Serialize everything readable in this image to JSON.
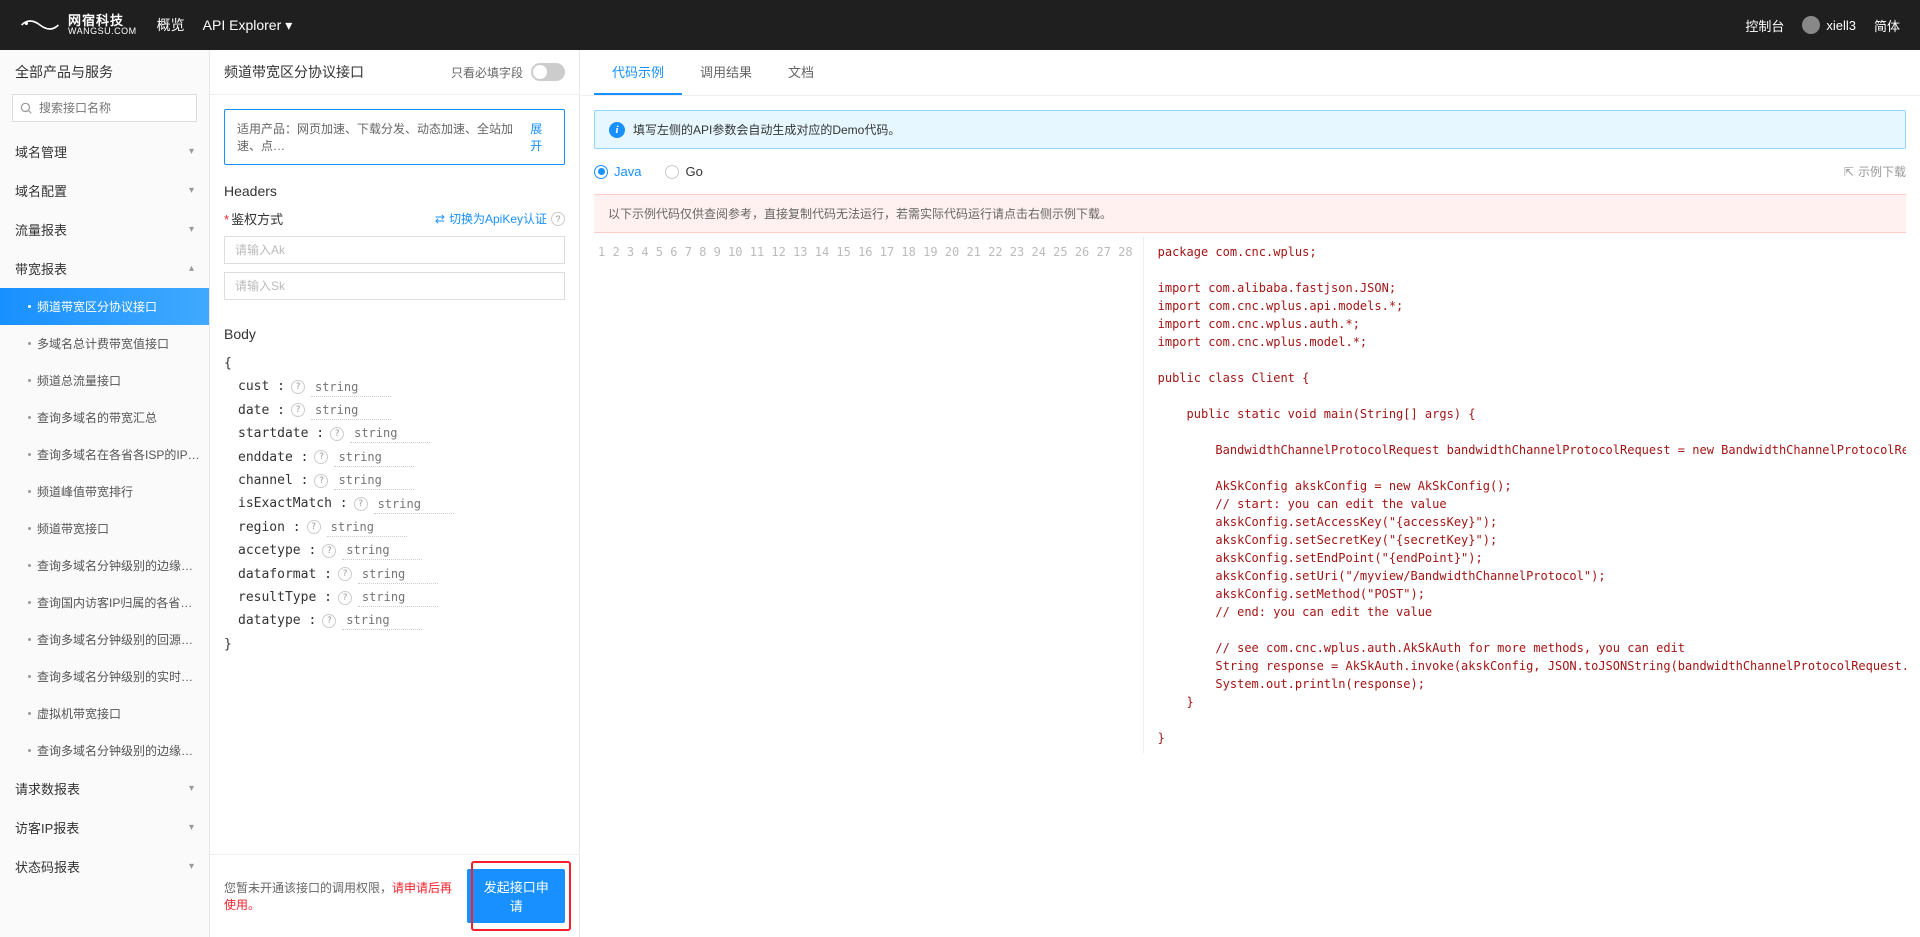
{
  "header": {
    "logo_cn": "网宿科技",
    "logo_en": "WANGSU.COM",
    "nav_overview": "概览",
    "nav_api_explorer": "API Explorer",
    "console": "控制台",
    "username": "xiell3",
    "lang": "简体"
  },
  "sidebar": {
    "title": "全部产品与服务",
    "search_placeholder": "搜索接口名称",
    "groups": [
      {
        "label": "域名管理",
        "expanded": false
      },
      {
        "label": "域名配置",
        "expanded": false
      },
      {
        "label": "流量报表",
        "expanded": false
      },
      {
        "label": "带宽报表",
        "expanded": true,
        "items": [
          "频道带宽区分协议接口",
          "多域名总计费带宽值接口",
          "频道总流量接口",
          "查询多域名的带宽汇总",
          "查询多域名在各省各ISP的IP…",
          "频道峰值带宽排行",
          "频道带宽接口",
          "查询多域名分钟级别的边缘…",
          "查询国内访客IP归属的各省…",
          "查询多域名分钟级别的回源…",
          "查询多域名分钟级别的实时…",
          "虚拟机带宽接口",
          "查询多域名分钟级别的边缘…"
        ]
      },
      {
        "label": "请求数报表",
        "expanded": false
      },
      {
        "label": "访客IP报表",
        "expanded": false
      },
      {
        "label": "状态码报表",
        "expanded": false
      }
    ]
  },
  "middle": {
    "title": "频道带宽区分协议接口",
    "required_only": "只看必填字段",
    "products_label": "适用产品：网页加速、下载分发、动态加速、全站加速、点…",
    "expand": "展开",
    "headers_title": "Headers",
    "auth_label": "鉴权方式",
    "auth_switch": "切换为ApiKey认证",
    "ak_placeholder": "请输入Ak",
    "sk_placeholder": "请输入Sk",
    "body_title": "Body",
    "body_fields": [
      {
        "key": "cust",
        "type": "string"
      },
      {
        "key": "date",
        "type": "string"
      },
      {
        "key": "startdate",
        "type": "string"
      },
      {
        "key": "enddate",
        "type": "string"
      },
      {
        "key": "channel",
        "type": "string"
      },
      {
        "key": "isExactMatch",
        "type": "string"
      },
      {
        "key": "region",
        "type": "string"
      },
      {
        "key": "accetype",
        "type": "string"
      },
      {
        "key": "dataformat",
        "type": "string"
      },
      {
        "key": "resultType",
        "type": "string"
      },
      {
        "key": "datatype",
        "type": "string"
      }
    ],
    "footer_warn_1": "您暂未开通该接口的调用权限，",
    "footer_warn_2": "请申请后再使用。",
    "submit": "发起接口申请"
  },
  "right": {
    "tabs": [
      "代码示例",
      "调用结果",
      "文档"
    ],
    "alert": "填写左侧的API参数会自动生成对应的Demo代码。",
    "lang_java": "Java",
    "lang_go": "Go",
    "download": "示例下载",
    "code_hint": "以下示例代码仅供查阅参考，直接复制代码无法运行，若需实际代码运行请点击右侧示例下载。",
    "code_lines": [
      "package com.cnc.wplus;",
      "",
      "import com.alibaba.fastjson.JSON;",
      "import com.cnc.wplus.api.models.*;",
      "import com.cnc.wplus.auth.*;",
      "import com.cnc.wplus.model.*;",
      "",
      "public class Client {",
      "",
      "    public static void main(String[] args) {",
      "",
      "        BandwidthChannelProtocolRequest bandwidthChannelProtocolRequest = new BandwidthChannelProtocolRequest();",
      "",
      "        AkSkConfig akskConfig = new AkSkConfig();",
      "        // start: you can edit the value",
      "        akskConfig.setAccessKey(\"{accessKey}\");",
      "        akskConfig.setSecretKey(\"{secretKey}\");",
      "        akskConfig.setEndPoint(\"{endPoint}\");",
      "        akskConfig.setUri(\"/myview/BandwidthChannelProtocol\");",
      "        akskConfig.setMethod(\"POST\");",
      "        // end: you can edit the value",
      "",
      "        // see com.cnc.wplus.auth.AkSkAuth for more methods, you can edit",
      "        String response = AkSkAuth.invoke(akskConfig, JSON.toJSONString(bandwidthChannelProtocolRequest.toMap()));",
      "        System.out.println(response);",
      "    }",
      "",
      "}"
    ]
  }
}
